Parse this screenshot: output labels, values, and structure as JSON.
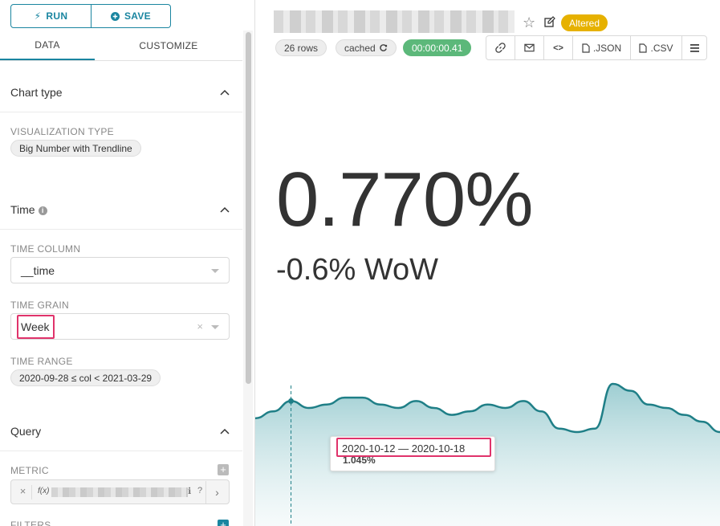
{
  "toolbar": {
    "run_label": "RUN",
    "save_label": "SAVE"
  },
  "tabs": {
    "data": "DATA",
    "customize": "CUSTOMIZE"
  },
  "chart_type": {
    "title": "Chart type",
    "viz_label": "VISUALIZATION TYPE",
    "viz_value": "Big Number with Trendline"
  },
  "time": {
    "title": "Time",
    "column_label": "TIME COLUMN",
    "column_value": "__time",
    "grain_label": "TIME GRAIN",
    "grain_value": "Week",
    "range_label": "TIME RANGE",
    "range_value": "2020-09-28 ≤ col < 2021-03-29"
  },
  "query": {
    "title": "Query",
    "metric_label": "METRIC",
    "filters_label": "FILTERS"
  },
  "header": {
    "badge": "Altered",
    "rows": "26 rows",
    "cached": "cached",
    "timer": "00:00:00.41",
    "json_label": ".JSON",
    "csv_label": ".CSV"
  },
  "big_number": {
    "value": "0.770%",
    "subheader": "-0.6% WoW"
  },
  "chart_data": {
    "type": "area",
    "y": [
      0.75,
      0.77,
      0.8,
      0.78,
      0.79,
      0.81,
      0.81,
      0.79,
      0.78,
      0.8,
      0.78,
      0.76,
      0.77,
      0.79,
      0.78,
      0.8,
      0.77,
      0.72,
      0.71,
      0.72,
      0.85,
      0.83,
      0.79,
      0.78,
      0.76,
      0.74,
      0.71
    ]
  },
  "tooltip": {
    "date": "2020-10-12 — 2020-10-18",
    "value": "1.045%"
  },
  "colors": {
    "accent": "#1a85a0",
    "highlight": "#e0336b",
    "altered": "#e6b100",
    "timer": "#5cb87a",
    "line": "#1f7f87"
  }
}
